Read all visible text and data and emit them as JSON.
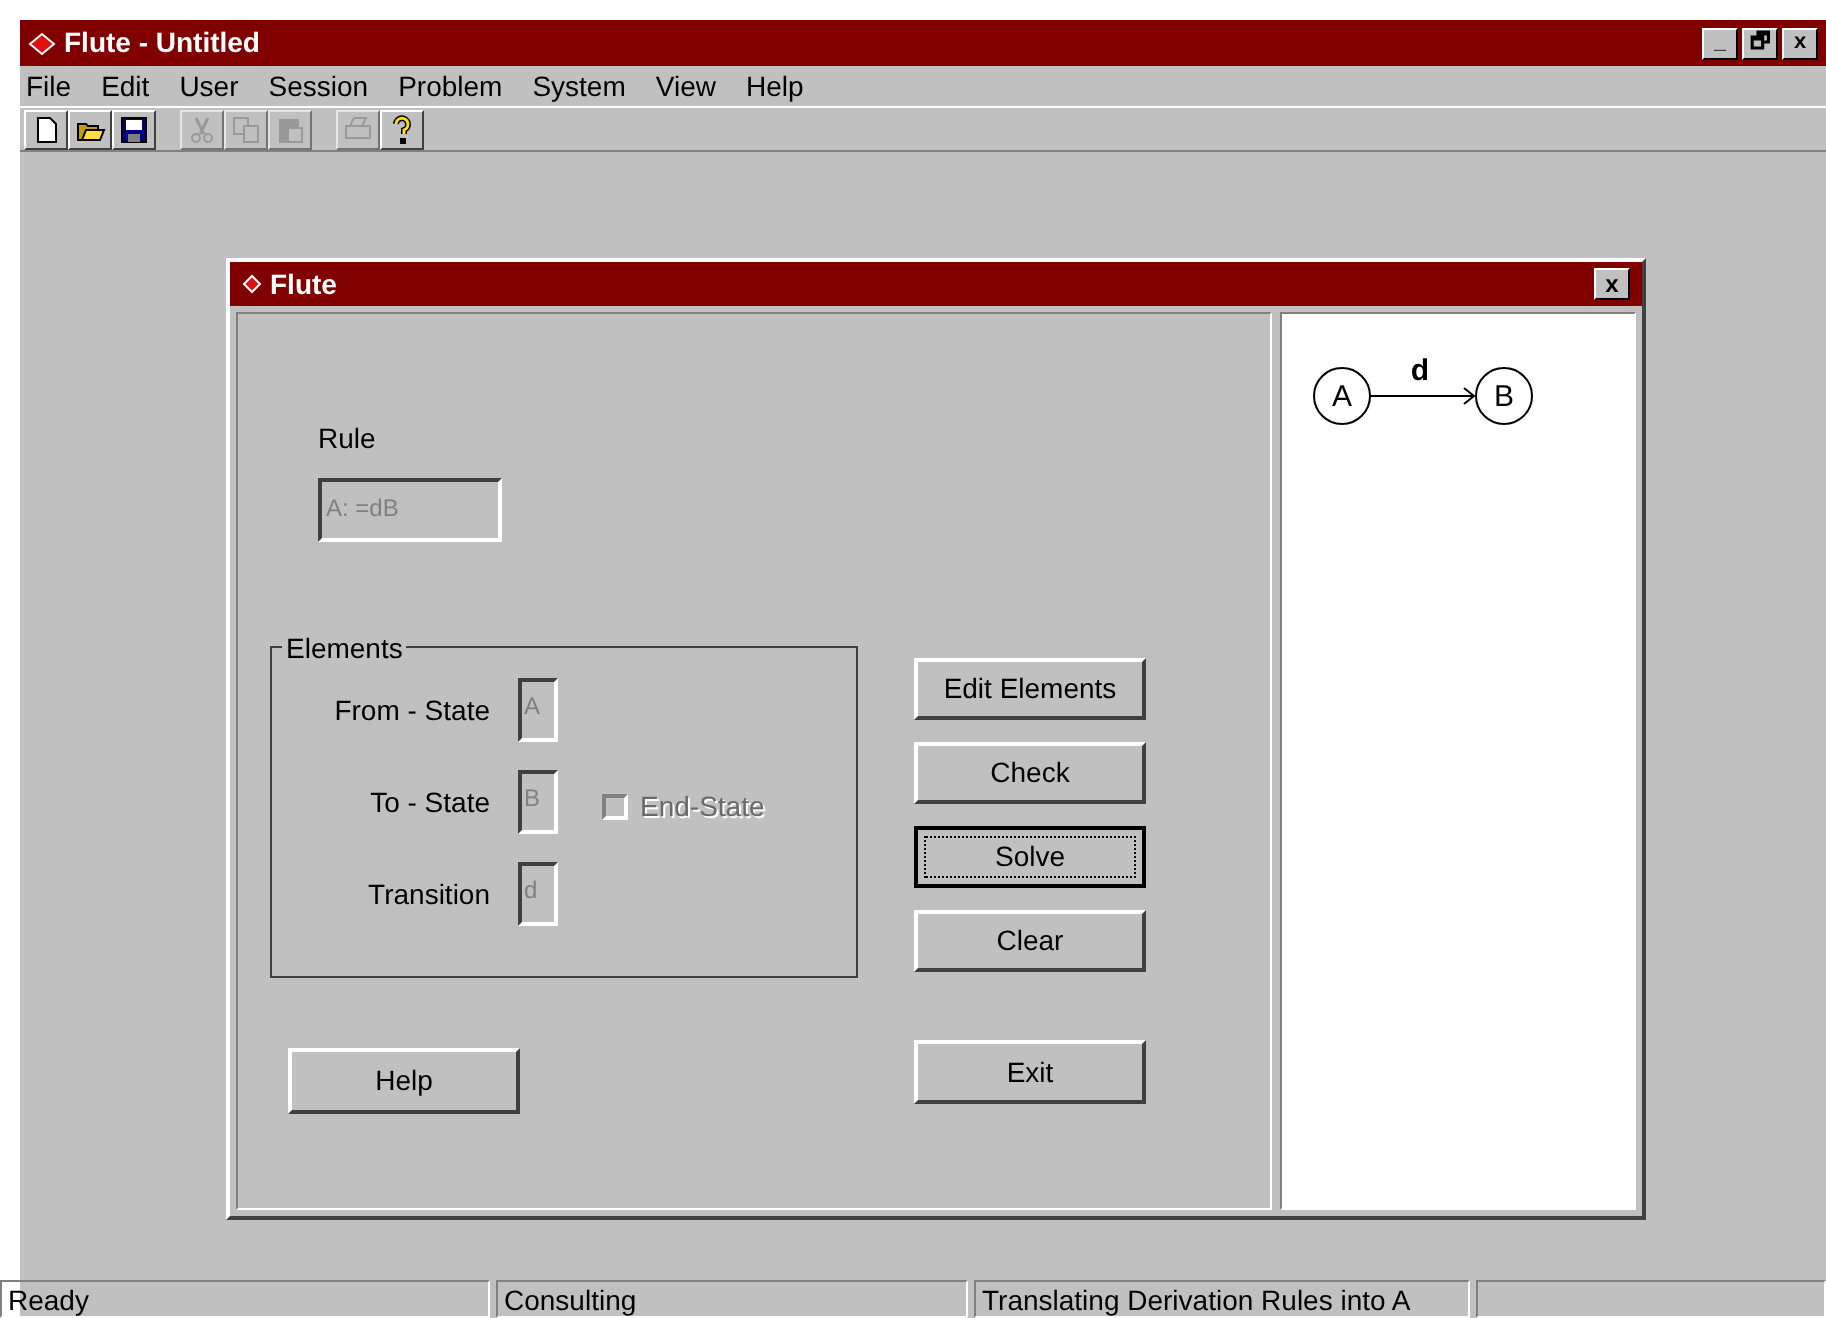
{
  "window": {
    "title": "Flute - Untitled",
    "controls": [
      "_",
      "🗗",
      "x"
    ]
  },
  "menu": [
    {
      "label": "File"
    },
    {
      "label": "Edit"
    },
    {
      "label": "User"
    },
    {
      "label": "Session"
    },
    {
      "label": "Problem"
    },
    {
      "label": "System"
    },
    {
      "label": "View"
    },
    {
      "label": "Help"
    }
  ],
  "toolbar": [
    {
      "kind": "new",
      "disabled": false
    },
    {
      "kind": "open",
      "disabled": false
    },
    {
      "kind": "save",
      "disabled": false
    },
    {
      "kind": "cut",
      "disabled": true
    },
    {
      "kind": "copy",
      "disabled": true
    },
    {
      "kind": "paste",
      "disabled": true
    },
    {
      "kind": "print",
      "disabled": true
    },
    {
      "kind": "help",
      "disabled": false
    }
  ],
  "dialog": {
    "title": "Flute",
    "close": "x",
    "rule": {
      "label": "Rule",
      "value": "A: =dB",
      "disabled": true
    },
    "elements": {
      "title": "Elements",
      "fields": [
        {
          "label": "From - State",
          "value": "A",
          "disabled": true
        },
        {
          "label": "To - State",
          "value": "B",
          "disabled": true
        },
        {
          "label": "Transition",
          "value": "d",
          "disabled": true
        }
      ],
      "end_state": {
        "label": "End-State",
        "checked": false,
        "disabled": true
      }
    },
    "buttons": [
      {
        "label": "Edit Elements",
        "focused": false
      },
      {
        "label": "Check",
        "focused": false
      },
      {
        "label": "Solve",
        "focused": true
      },
      {
        "label": "Clear",
        "focused": false
      }
    ],
    "help_button": "Help",
    "exit_button": "Exit",
    "diagram": {
      "nodes": [
        {
          "label": "A"
        },
        {
          "label": "B"
        }
      ],
      "edges": [
        {
          "label": "d"
        }
      ]
    }
  },
  "status_bar": [
    "Ready",
    "Consulting",
    "Translating Derivation Rules into A"
  ]
}
